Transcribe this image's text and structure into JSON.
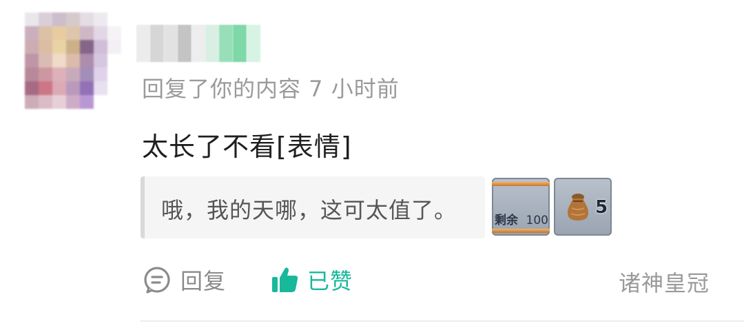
{
  "notification": {
    "meta_text": "回复了你的内容 7 小时前",
    "comment_text": "太长了不看[表情]",
    "quoted_content": "哦，我的天哪，这可太值了。",
    "items": {
      "remain_label": "剩余",
      "remain_value": "100",
      "bag_icon": "money-bag-icon",
      "bag_count": "5"
    },
    "actions": {
      "reply_label": "回复",
      "reply_icon": "comment-bubble-icon",
      "like_label": "已赞",
      "like_icon": "thumbs-up-icon",
      "like_color": "#18b89a"
    },
    "badge_text": "诸神皇冠"
  }
}
